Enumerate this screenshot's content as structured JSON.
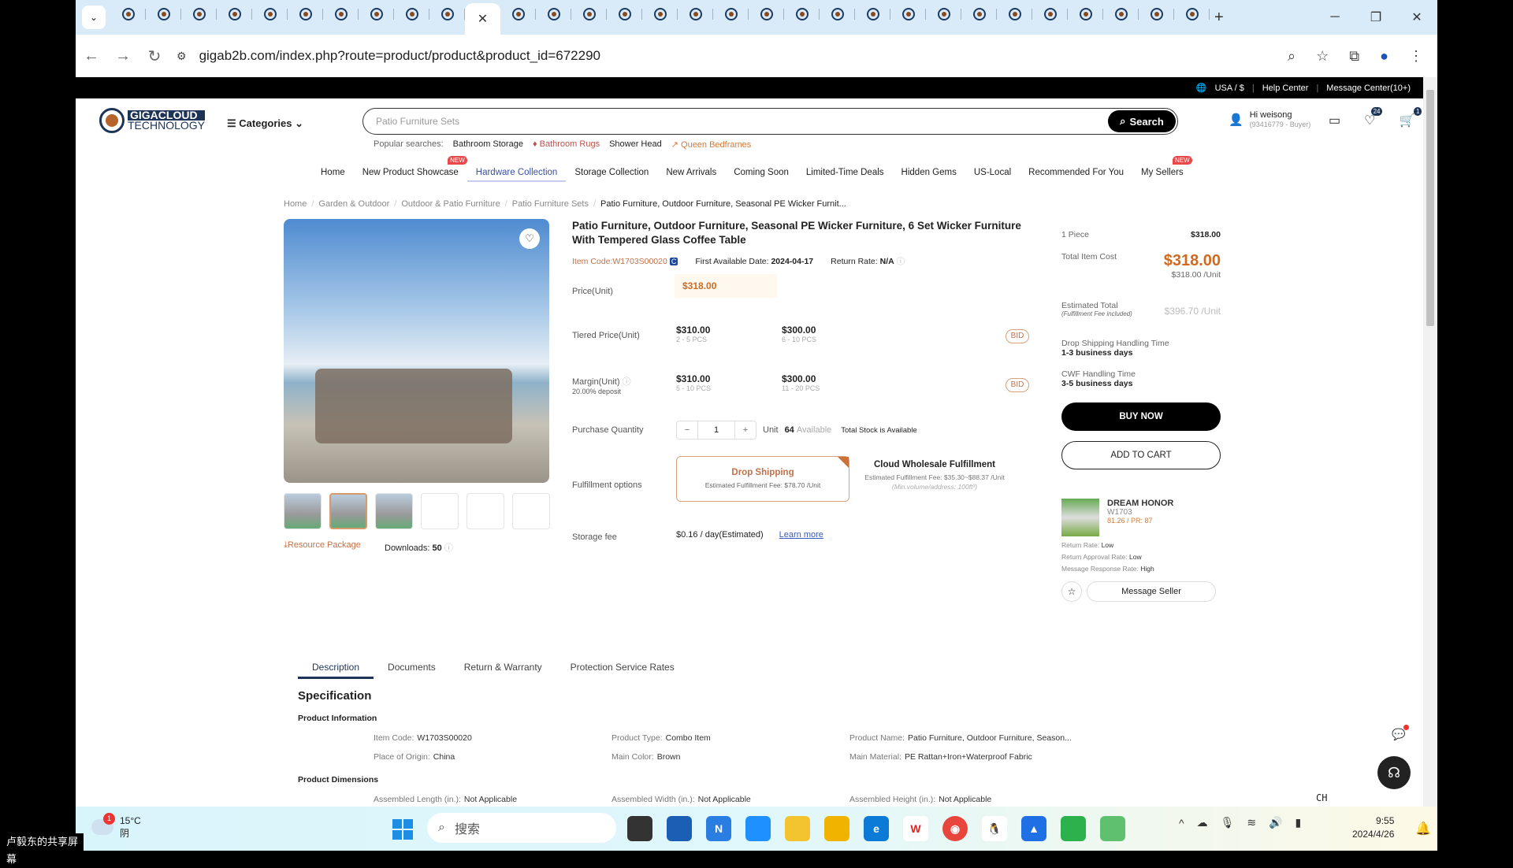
{
  "browser": {
    "tab_count": 31,
    "active_tab_index": 10,
    "url": "gigab2b.com/index.php?route=product/product&product_id=672290",
    "controls": {
      "minimize": "─",
      "restore": "❐",
      "close": "✕"
    }
  },
  "topbar": {
    "region": "USA / $",
    "help": "Help Center",
    "messages": "Message Center(10+)"
  },
  "header": {
    "logo_line1": "GIGACLOUD",
    "logo_line2": "TECHNOLOGY",
    "categories": "Categories",
    "search_placeholder": "Patio Furniture Sets",
    "search_button": "Search",
    "popular_label": "Popular searches:",
    "popular": [
      "Bathroom Storage",
      "Bathroom Rugs",
      "Shower Head",
      "Queen Bedframes"
    ],
    "user_greeting": "Hi weisong",
    "user_id": "(93416779 - Buyer)",
    "wishlist_count": "24",
    "cart_count": "1"
  },
  "mainnav": [
    {
      "label": "Home",
      "badge": ""
    },
    {
      "label": "New Product Showcase",
      "badge": "NEW"
    },
    {
      "label": "Hardware Collection",
      "badge": ""
    },
    {
      "label": "Storage Collection",
      "badge": ""
    },
    {
      "label": "New Arrivals",
      "badge": ""
    },
    {
      "label": "Coming Soon",
      "badge": ""
    },
    {
      "label": "Limited-Time Deals",
      "badge": ""
    },
    {
      "label": "Hidden Gems",
      "badge": ""
    },
    {
      "label": "US-Local",
      "badge": ""
    },
    {
      "label": "Recommended For You",
      "badge": ""
    },
    {
      "label": "My Sellers",
      "badge": "NEW"
    }
  ],
  "breadcrumb": [
    "Home",
    "Garden & Outdoor",
    "Outdoor & Patio Furniture",
    "Patio Furniture Sets",
    "Patio Furniture, Outdoor Furniture, Seasonal PE Wicker Furnit..."
  ],
  "gallery": {
    "thumbnail_count": 6,
    "selected_thumbnail": 2,
    "resource_package": "Resource Package",
    "downloads_label": "Downloads:",
    "downloads": "50"
  },
  "product": {
    "title": "Patio Furniture, Outdoor Furniture, Seasonal PE Wicker Furniture, 6 Set Wicker Furniture With Tempered Glass Coffee Table",
    "item_code": "Item Code:W1703S00020",
    "item_code_badge": "C",
    "first_available_label": "First Available Date:",
    "first_available": "2024-04-17",
    "return_rate_label": "Return Rate:",
    "return_rate": "N/A",
    "price_label": "Price(Unit)",
    "price": "$318.00",
    "tiered_label": "Tiered Price(Unit)",
    "tiers": [
      {
        "price": "$310.00",
        "range": "2 - 5 PCS"
      },
      {
        "price": "$300.00",
        "range": "6 - 10 PCS"
      }
    ],
    "margin_label": "Margin(Unit)",
    "margin_sub": "20.00% deposit",
    "margins": [
      {
        "price": "$310.00",
        "range": "5 - 10 PCS"
      },
      {
        "price": "$300.00",
        "range": "11 - 20 PCS"
      }
    ],
    "bid": "BID",
    "qty_label": "Purchase Quantity",
    "qty": "1",
    "unit": "Unit",
    "available_count": "64",
    "available_label": "Available",
    "stock_note": "Total Stock is Available",
    "fulfillment_label": "Fulfillment options",
    "drop_shipping": {
      "title": "Drop Shipping",
      "fee": "Estimated Fulfillment Fee: $78.70 /Unit"
    },
    "cwf": {
      "title": "Cloud Wholesale Fulfillment",
      "fee": "Estimated Fulfillment Fee: $35.30~$88.37 /Unit",
      "note": "(Min.volume/address: 100ft³)"
    },
    "storage_label": "Storage fee",
    "storage_value": "$0.16 / day(Estimated)",
    "learn_more": "Learn more"
  },
  "summary": {
    "qty_label": "1 Piece",
    "qty_price": "$318.00",
    "total_label": "Total Item Cost",
    "total": "$318.00",
    "per_unit": "$318.00 /Unit",
    "est_label": "Estimated Total",
    "est_sub": "(Fulfillment Fee included)",
    "est_value": "$396.70 /Unit",
    "ds_label": "Drop Shipping Handling Time",
    "ds_value": "1-3 business days",
    "cwf_label": "CWF Handling Time",
    "cwf_value": "3-5 business days",
    "buy_now": "BUY NOW",
    "add_to_cart": "ADD TO CART"
  },
  "seller": {
    "name": "DREAM HONOR",
    "code": "W1703",
    "rating": "81.26 / PR: 87",
    "stats": [
      {
        "label": "Return Rate:",
        "value": "Low"
      },
      {
        "label": "Return Approval Rate:",
        "value": "Low"
      },
      {
        "label": "Message Response Rate:",
        "value": "High"
      }
    ],
    "message_button": "Message Seller"
  },
  "detail_tabs": [
    "Description",
    "Documents",
    "Return & Warranty",
    "Protection Service Rates"
  ],
  "spec": {
    "title": "Specification",
    "info_title": "Product Information",
    "info": [
      {
        "label": "Item Code:",
        "value": "W1703S00020"
      },
      {
        "label": "Product Type:",
        "value": "Combo Item"
      },
      {
        "label": "Product Name:",
        "value": "Patio Furniture, Outdoor Furniture, Season..."
      },
      {
        "label": "Place of Origin:",
        "value": "China"
      },
      {
        "label": "Main Color:",
        "value": "Brown"
      },
      {
        "label": "Main Material:",
        "value": "PE Rattan+Iron+Waterproof Fabric"
      }
    ],
    "dim_title": "Product Dimensions",
    "dims": [
      {
        "label": "Assembled Length (in.):",
        "value": "Not Applicable"
      },
      {
        "label": "Assembled Width (in.):",
        "value": "Not Applicable"
      },
      {
        "label": "Assembled Height (in.):",
        "value": "Not Applicable"
      }
    ]
  },
  "taskbar": {
    "share_label": "卢毅东的共享屏幕",
    "weather_temp": "15°C",
    "weather_desc": "阴",
    "weather_badge": "1",
    "search_placeholder": "搜索",
    "ime": "CH",
    "time": "9:55",
    "date": "2024/4/26"
  }
}
